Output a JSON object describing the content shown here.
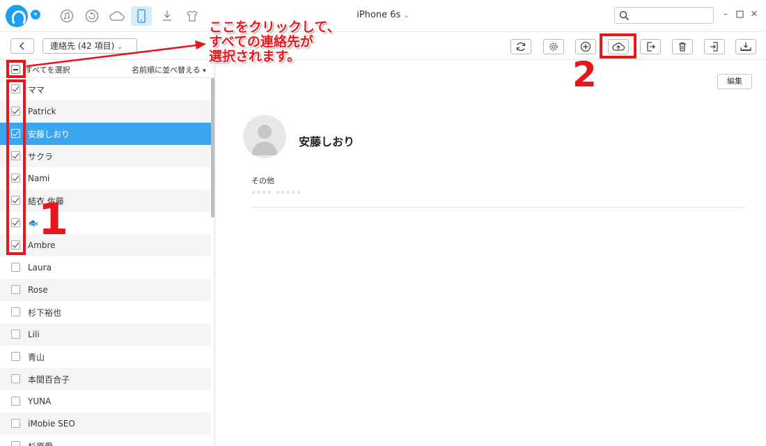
{
  "window": {
    "device_title": "iPhone 6s"
  },
  "toolbar": {
    "category_label": "連絡先 (42 項目)"
  },
  "list_header": {
    "select_all": "すべてを選択",
    "sort": "名前順に並べ替える"
  },
  "contacts": [
    {
      "name": "ママ",
      "checked": true
    },
    {
      "name": "Patrick",
      "checked": true
    },
    {
      "name": "安藤しおり",
      "checked": true,
      "selected": true
    },
    {
      "name": "サクラ",
      "checked": true
    },
    {
      "name": "Nami",
      "checked": true
    },
    {
      "name": "結衣 佐藤",
      "checked": true
    },
    {
      "name": "🐟",
      "checked": true
    },
    {
      "name": "Ambre",
      "checked": true
    },
    {
      "name": "Laura",
      "checked": false
    },
    {
      "name": "Rose",
      "checked": false
    },
    {
      "name": "杉下裕也",
      "checked": false
    },
    {
      "name": "Lili",
      "checked": false
    },
    {
      "name": "青山",
      "checked": false
    },
    {
      "name": "本間百合子",
      "checked": false
    },
    {
      "name": "YUNA",
      "checked": false
    },
    {
      "name": "iMobie SEO",
      "checked": false
    },
    {
      "name": "杉原愛",
      "checked": false
    }
  ],
  "detail": {
    "edit_label": "編集",
    "name": "安藤しおり",
    "field_label": "その他",
    "field_value": "•••• •••••"
  },
  "annotations": {
    "callout": [
      "ここをクリックして、",
      "すべての連絡先が",
      "選択されます。"
    ],
    "step1": "1",
    "step2": "2"
  },
  "colors": {
    "accent": "#1ea0f0",
    "selected_row": "#39a6ee",
    "annotation": "#e8161b"
  }
}
